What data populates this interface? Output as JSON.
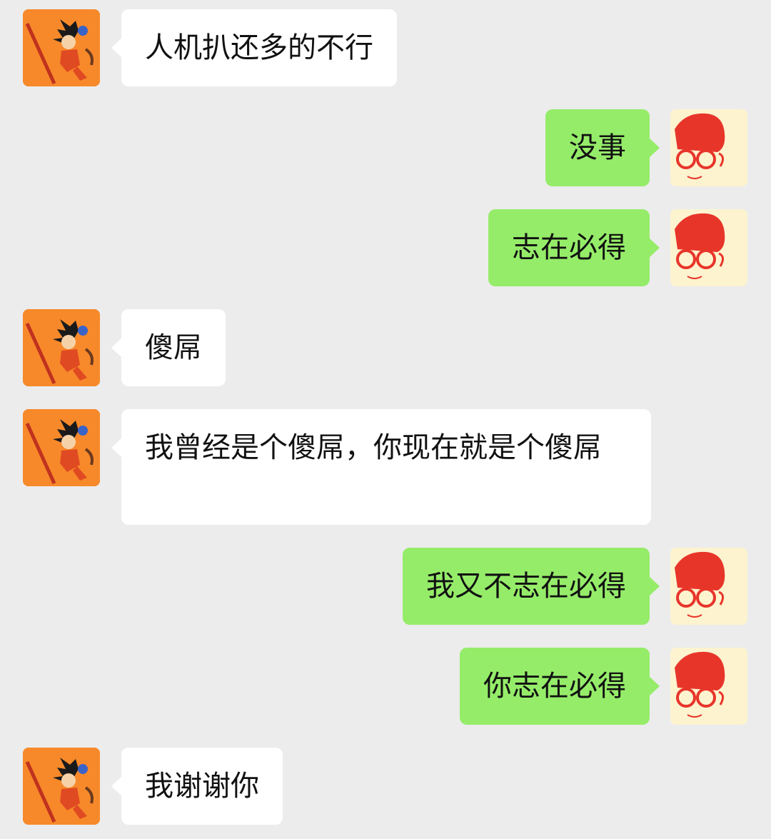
{
  "messages": [
    {
      "side": "left",
      "text": "人机扒还多的不行"
    },
    {
      "side": "right",
      "text": "没事"
    },
    {
      "side": "right",
      "text": "志在必得"
    },
    {
      "side": "left",
      "text": "傻屌"
    },
    {
      "side": "left",
      "text": "我曾经是个傻屌，你现在就是个傻屌"
    },
    {
      "side": "right",
      "text": "我又不志在必得"
    },
    {
      "side": "right",
      "text": "你志在必得"
    },
    {
      "side": "left",
      "text": "我谢谢你"
    }
  ],
  "colors": {
    "background": "#ececec",
    "received_bubble": "#ffffff",
    "sent_bubble": "#95ec69",
    "goku_avatar_bg": "#f7892a",
    "girl_avatar_bg": "#fdf3cf",
    "girl_avatar_line": "#e8352a"
  },
  "icons": {
    "left_avatar": "goku-avatar-icon",
    "right_avatar": "red-hair-glasses-girl-avatar-icon"
  }
}
